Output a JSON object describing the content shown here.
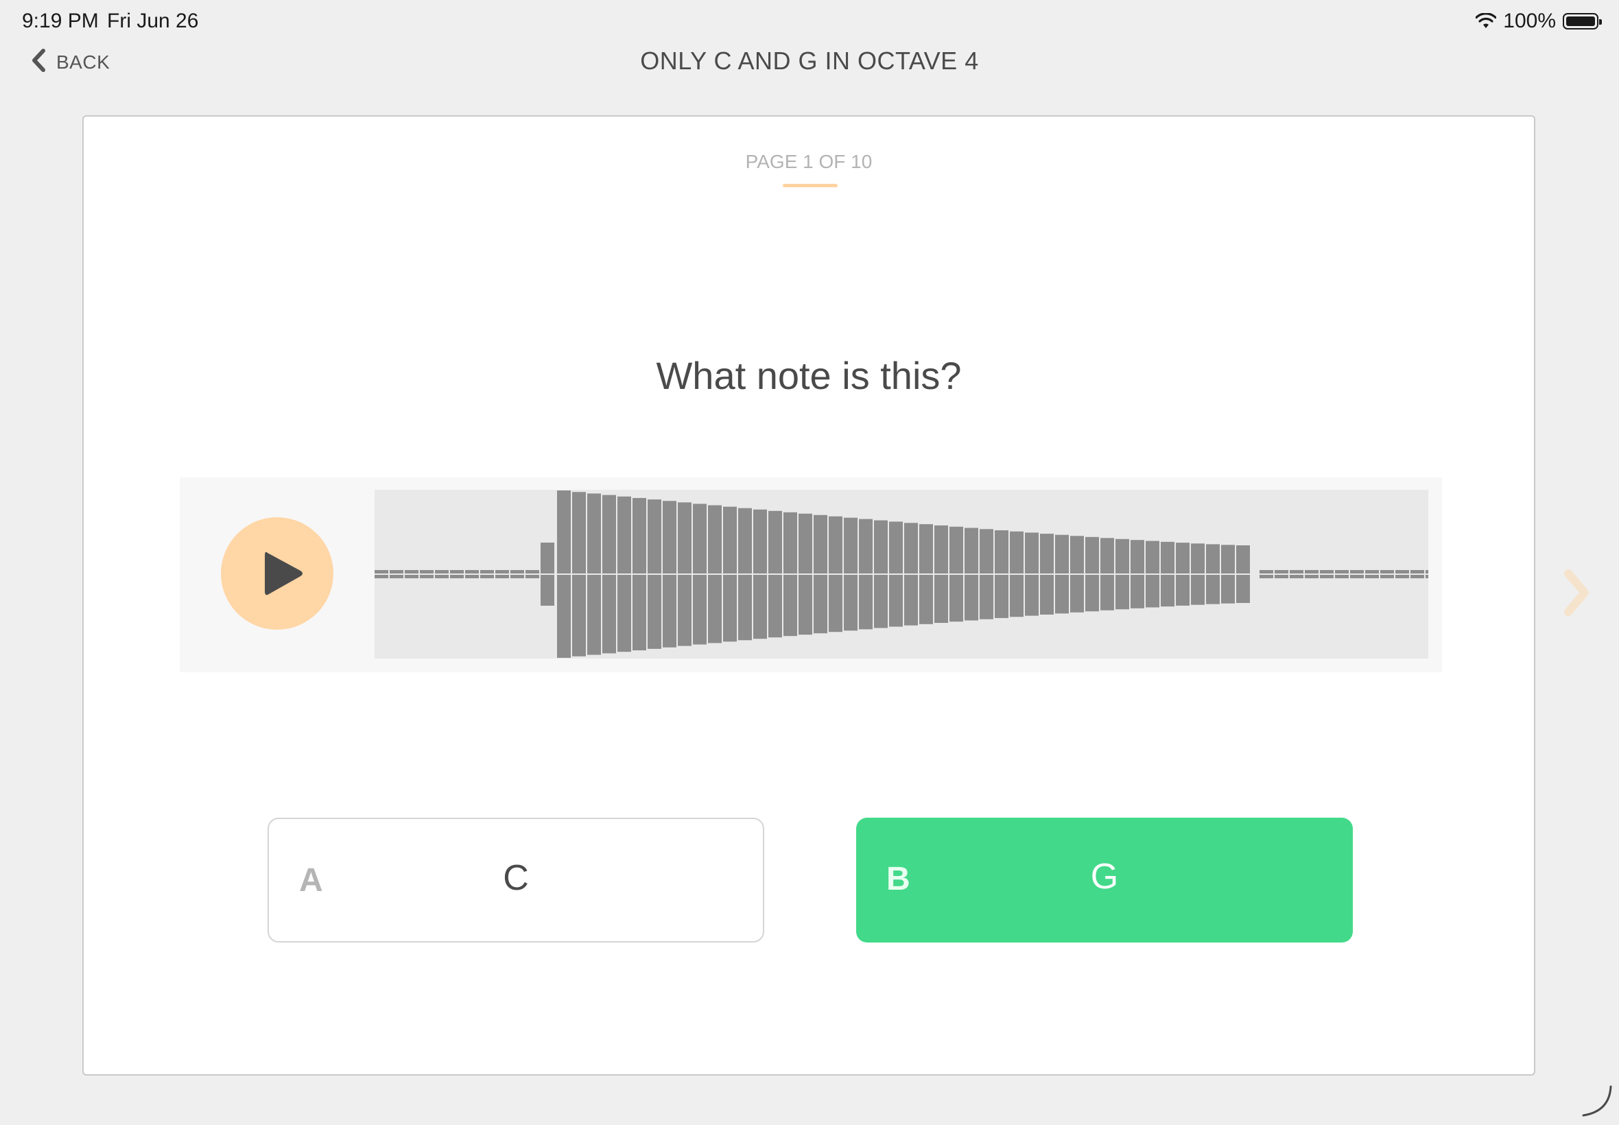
{
  "status_bar": {
    "time": "9:19 PM",
    "date": "Fri Jun 26",
    "battery": "100%"
  },
  "nav": {
    "back_label": "BACK",
    "title": "ONLY C AND G IN OCTAVE 4"
  },
  "card": {
    "page_label": "PAGE 1 OF 10",
    "question": "What note is this?",
    "answers": [
      {
        "letter": "A",
        "text": "C",
        "state": "default"
      },
      {
        "letter": "B",
        "text": "G",
        "state": "correct"
      }
    ]
  },
  "colors": {
    "accent": "#ffd6a6",
    "correct": "#43d98a",
    "waveform_bars": "#8c8c8c",
    "waveform_background": "#e9e9e9"
  },
  "icons": {
    "back": "chevron-left-icon",
    "play": "play-icon",
    "next": "chevron-right-icon",
    "wifi": "wifi-icon",
    "battery": "battery-icon"
  }
}
